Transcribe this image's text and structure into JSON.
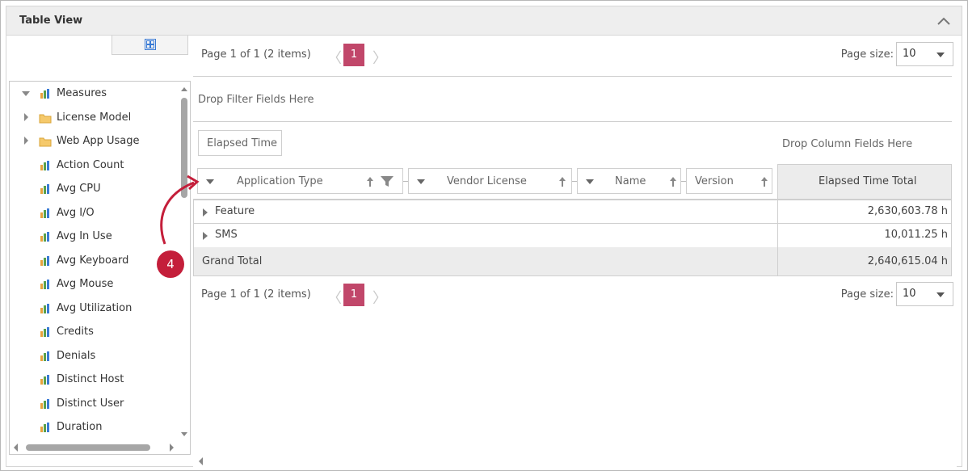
{
  "panel": {
    "title": "Table View"
  },
  "field_list": {
    "items": [
      {
        "label": "Measures",
        "type": "measures",
        "expander": "expanded"
      },
      {
        "label": "License Model",
        "type": "folder",
        "expander": "collapsed"
      },
      {
        "label": "Web App Usage",
        "type": "folder",
        "expander": "collapsed"
      },
      {
        "label": "Action Count",
        "type": "measure"
      },
      {
        "label": "Avg CPU",
        "type": "measure"
      },
      {
        "label": "Avg I/O",
        "type": "measure"
      },
      {
        "label": "Avg In Use",
        "type": "measure"
      },
      {
        "label": "Avg Keyboard",
        "type": "measure"
      },
      {
        "label": "Avg Mouse",
        "type": "measure"
      },
      {
        "label": "Avg Utilization",
        "type": "measure"
      },
      {
        "label": "Credits",
        "type": "measure"
      },
      {
        "label": "Denials",
        "type": "measure"
      },
      {
        "label": "Distinct Host",
        "type": "measure"
      },
      {
        "label": "Distinct User",
        "type": "measure"
      },
      {
        "label": "Duration",
        "type": "measure"
      }
    ]
  },
  "pager_top": {
    "summary": "Page 1 of 1 (2 items)",
    "current_page": "1",
    "size_label": "Page size:",
    "size_value": "10"
  },
  "pager_bottom": {
    "summary": "Page 1 of 1 (2 items)",
    "current_page": "1",
    "size_label": "Page size:",
    "size_value": "10"
  },
  "filter_area": {
    "placeholder": "Drop Filter Fields Here"
  },
  "data_area": {
    "field": "Elapsed Time"
  },
  "column_area": {
    "placeholder": "Drop Column Fields Here"
  },
  "row_fields": [
    {
      "label": "Application Type",
      "filtered": true
    },
    {
      "label": "Vendor License",
      "filtered": false
    },
    {
      "label": "Name",
      "filtered": false
    },
    {
      "label": "Version",
      "filtered": false
    }
  ],
  "grid": {
    "total_header": "Elapsed Time Total",
    "rows": [
      {
        "label": "Feature",
        "value": "2,630,603.78 h"
      },
      {
        "label": "SMS",
        "value": "10,011.25 h"
      }
    ],
    "grand_total": {
      "label": "Grand Total",
      "value": "2,640,615.04 h"
    }
  },
  "callout": {
    "number": "4"
  },
  "colors": {
    "accent": "#c1476a",
    "callout": "#c41e3a",
    "header_bg": "#eeeeee"
  }
}
